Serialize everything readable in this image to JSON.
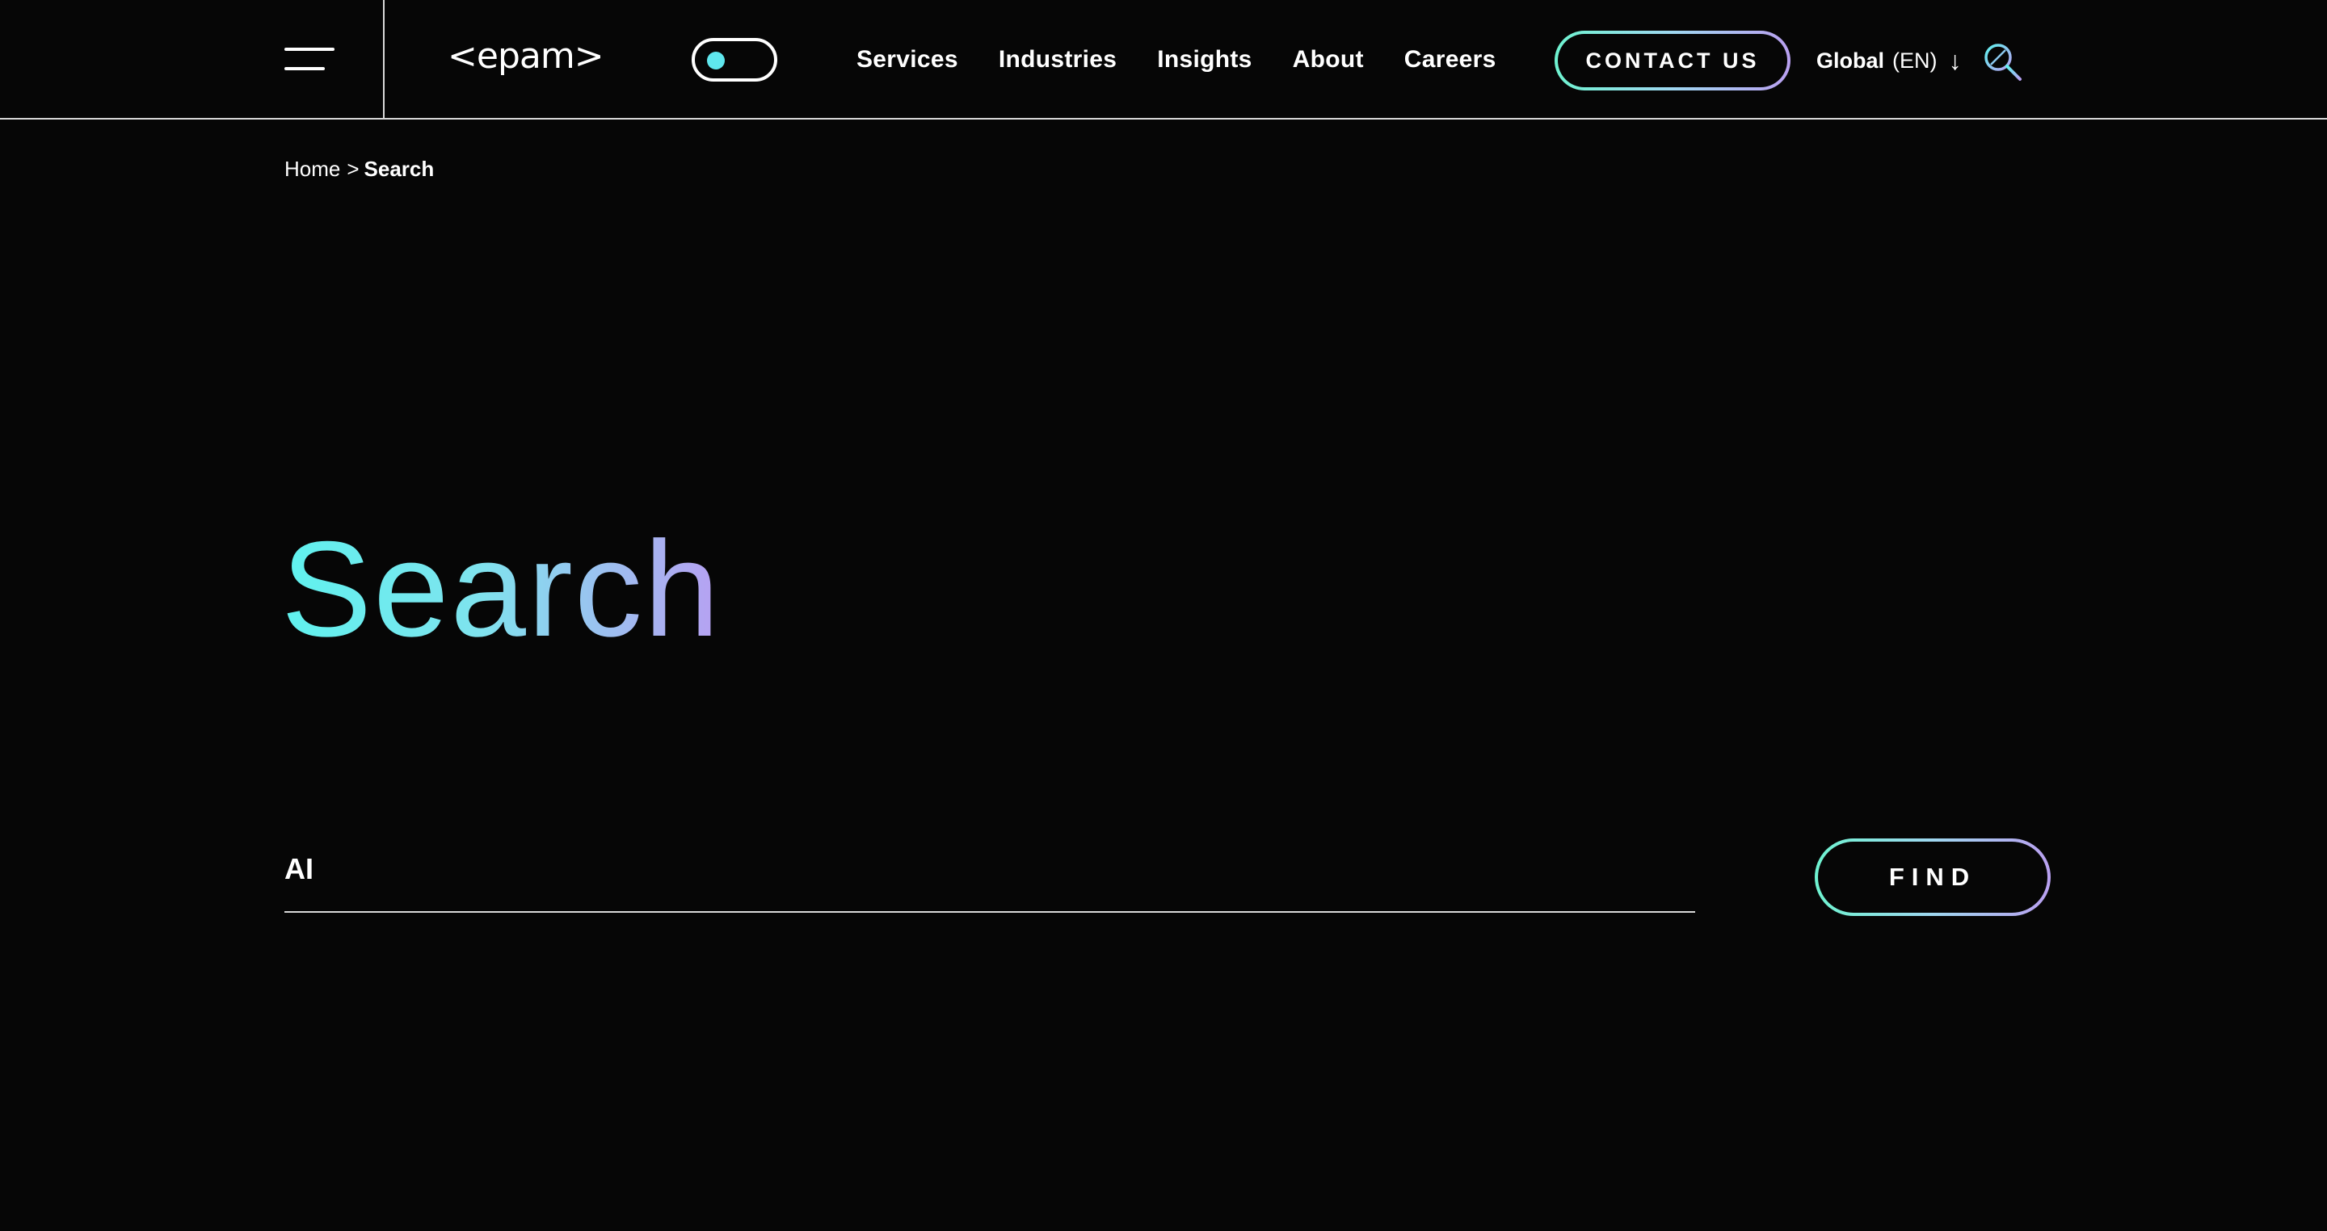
{
  "header": {
    "logo_text": "<epam>",
    "nav": [
      {
        "label": "Services"
      },
      {
        "label": "Industries"
      },
      {
        "label": "Insights"
      },
      {
        "label": "About"
      },
      {
        "label": "Careers"
      }
    ],
    "contact_label": "CONTACT US",
    "locale": {
      "region": "Global",
      "language": "(EN)"
    }
  },
  "breadcrumb": {
    "home": "Home",
    "separator": ">",
    "current": "Search"
  },
  "page": {
    "title": "Search"
  },
  "search": {
    "value": "AI",
    "button_label": "FIND"
  },
  "colors": {
    "background": "#060606",
    "accent_start": "#5ff2ee",
    "accent_end": "#b7a0f2",
    "text": "#ffffff"
  },
  "icons": {
    "menu": "hamburger-menu-icon",
    "theme_toggle": "toggle-switch",
    "locale_arrow": "arrow-down-icon",
    "search": "search-icon"
  }
}
